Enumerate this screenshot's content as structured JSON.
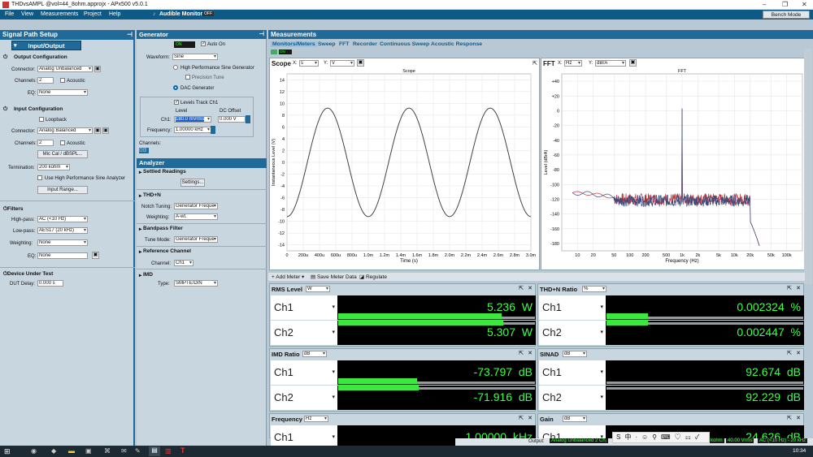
{
  "window": {
    "title": "THDvsAMPL @vol=44_8ohm.approjx - APx500 v5.0.1",
    "controls": [
      "–",
      "❐",
      "✕"
    ]
  },
  "menu": {
    "file": "File",
    "view": "View",
    "measurements": "Measurements",
    "project": "Project",
    "help": "Help",
    "audible": "Audible Monitor",
    "audible_state": "OFF",
    "bench_mode": "Bench Mode"
  },
  "signal_path": {
    "title": "Signal Path Setup",
    "io_button": "Input/Output",
    "output": {
      "heading": "Output Configuration",
      "connector_label": "Connector:",
      "connector": "Analog Unbalanced",
      "channels_label": "Channels:",
      "channels": "2",
      "acoustic": "Acoustic",
      "eq_label": "EQ:",
      "eq": "None"
    },
    "input": {
      "heading": "Input Configuration",
      "loopback": "Loopback",
      "connector_label": "Connector:",
      "connector": "Analog Balanced",
      "channels_label": "Channels:",
      "channels": "2",
      "acoustic": "Acoustic",
      "mic_cal": "Mic Cal / dBSPL...",
      "termination_label": "Termination:",
      "termination": "200 kohm",
      "hp_sine": "Use High Performance Sine Analyzer",
      "input_range": "Input Range..."
    },
    "filters": {
      "heading": "Filters",
      "highpass_label": "High-pass:",
      "highpass": "AC (<10 Hz)",
      "lowpass_label": "Low-pass:",
      "lowpass": "AES17 (20 kHz)",
      "weighting_label": "Weighting:",
      "weighting": "None",
      "eq_label": "EQ:",
      "eq": "None"
    },
    "dut": {
      "heading": "Device Under Test",
      "delay_label": "DUT Delay:",
      "delay": "0.000 s"
    }
  },
  "generator": {
    "title": "Generator",
    "on": "ON",
    "auto_on": "Auto On",
    "waveform_label": "Waveform:",
    "waveform": "Sine",
    "hp_sine": "High Performance Sine Generator",
    "precision": "Precision Tune",
    "dac": "DAC Generator",
    "levels_track": "Levels Track Ch1",
    "level_hdr": "Level",
    "dc_hdr": "DC Offset",
    "ch1_label": "Ch1:",
    "level": "180.0 mVrms",
    "dc": "0.000 V",
    "freq_label": "Frequency:",
    "freq": "1.00000 kHz",
    "channels_label": "Channels:"
  },
  "analyzer": {
    "title": "Analyzer",
    "settled": "Settled Readings",
    "settings": "Settings...",
    "thdn": "THD+N",
    "notch_label": "Notch Tuning:",
    "notch": "Generator Freque",
    "weighting_label": "Weighting:",
    "weighting": "A-wt.",
    "bandpass": "Bandpass Filter",
    "tune_label": "Tune Mode:",
    "tune": "Generator Freque",
    "ref": "Reference Channel",
    "ref_ch_label": "Channel:",
    "ref_ch": "Ch1",
    "imd": "IMD",
    "type_label": "Type:",
    "type": "SMPTE/DIN"
  },
  "measurements": {
    "title": "Measurements",
    "on": "ON",
    "tabs": [
      "Monitors/Meters",
      "Sweep",
      "FFT",
      "Recorder",
      "Continuous Sweep",
      "Acoustic Response"
    ]
  },
  "scope": {
    "label": "Scope",
    "x_sel": "s",
    "y_sel": "V"
  },
  "fft": {
    "label": "FFT",
    "x_sel": "Hz",
    "y_sel": "dBrA"
  },
  "meter_toolbar": {
    "add": "Add Meter",
    "save": "Save Meter Data",
    "regulate": "Regulate"
  },
  "meters": [
    {
      "title": "RMS Level",
      "unit_sel": "W",
      "unit": "W",
      "ch1": "5.236",
      "ch2": "5.307",
      "bar1": 0.83,
      "bar2": 0.84
    },
    {
      "title": "THD+N Ratio",
      "unit_sel": "%",
      "unit": "%",
      "ch1": "0.002324",
      "ch2": "0.002447",
      "bar1": 0.21,
      "bar2": 0.21
    },
    {
      "title": "IMD Ratio",
      "unit_sel": "dB",
      "unit": "dB",
      "ch1": "-73.797",
      "ch2": "-71.916",
      "bar1": 0.4,
      "bar2": 0.41
    },
    {
      "title": "SINAD",
      "unit_sel": "dB",
      "unit": "dB",
      "ch1": "92.674",
      "ch2": "92.229",
      "bar1": 0.0,
      "bar2": 0.0
    },
    {
      "title": "Frequency",
      "unit_sel": "Hz",
      "unit": "kHz",
      "ch1": "1.00000",
      "ch2": ""
    },
    {
      "title": "Gain",
      "unit_sel": "dB",
      "unit": "dB",
      "ch1": "24.626",
      "ch2": ""
    }
  ],
  "channel_labels": [
    "Ch1",
    "Ch2"
  ],
  "status": {
    "output_label": "Output:",
    "output": "Analog Unbalanced 2 Ch,",
    "ohm": "kohm",
    "vrms": "40.00 Vrms",
    "ac": "AC (<10 Hz) - 20 kHz",
    "time": "10:34"
  },
  "chart_data": [
    {
      "type": "line",
      "title": "Scope",
      "xlabel": "Time (s)",
      "ylabel": "Instantaneous Level (V)",
      "xlim": [
        0,
        0.003
      ],
      "ylim": [
        -15,
        15
      ],
      "x_ticks": [
        "0",
        "200u",
        "400u",
        "600u",
        "800u",
        "1.0m",
        "1.2m",
        "1.4m",
        "1.6m",
        "1.8m",
        "2.0m",
        "2.2m",
        "2.4m",
        "2.6m",
        "2.8m",
        "3.0m"
      ],
      "y_ticks": [
        "14",
        "12",
        "10",
        "8",
        "6",
        "4",
        "2",
        "0",
        "-2",
        "-4",
        "-6",
        "-8",
        "-10",
        "-12",
        "-14"
      ],
      "series": [
        {
          "amplitude": 9.2,
          "frequency_hz": 1000,
          "phase_deg": -90,
          "color": "#444444"
        }
      ],
      "grid": true
    },
    {
      "type": "line",
      "title": "FFT",
      "xlabel": "Frequency (Hz)",
      "ylabel": "Level (dBrA)",
      "xscale": "log",
      "xlim": [
        5,
        200000
      ],
      "ylim": [
        -190,
        50
      ],
      "x_ticks": [
        "10",
        "20",
        "50",
        "100",
        "200",
        "500",
        "1k",
        "2k",
        "5k",
        "10k",
        "20k",
        "50k",
        "100k"
      ],
      "y_ticks": [
        "+40",
        "+20",
        "0",
        "-20",
        "-40",
        "-60",
        "-80",
        "-100",
        "-120",
        "-140",
        "-160",
        "-180"
      ],
      "fundamental": {
        "freq": 1000,
        "level": 3
      },
      "noise_floor": -120,
      "cutoff_hz": 20000,
      "series": [
        {
          "color": "#c0303a"
        },
        {
          "color": "#3a4a7a"
        }
      ],
      "grid": true
    }
  ]
}
